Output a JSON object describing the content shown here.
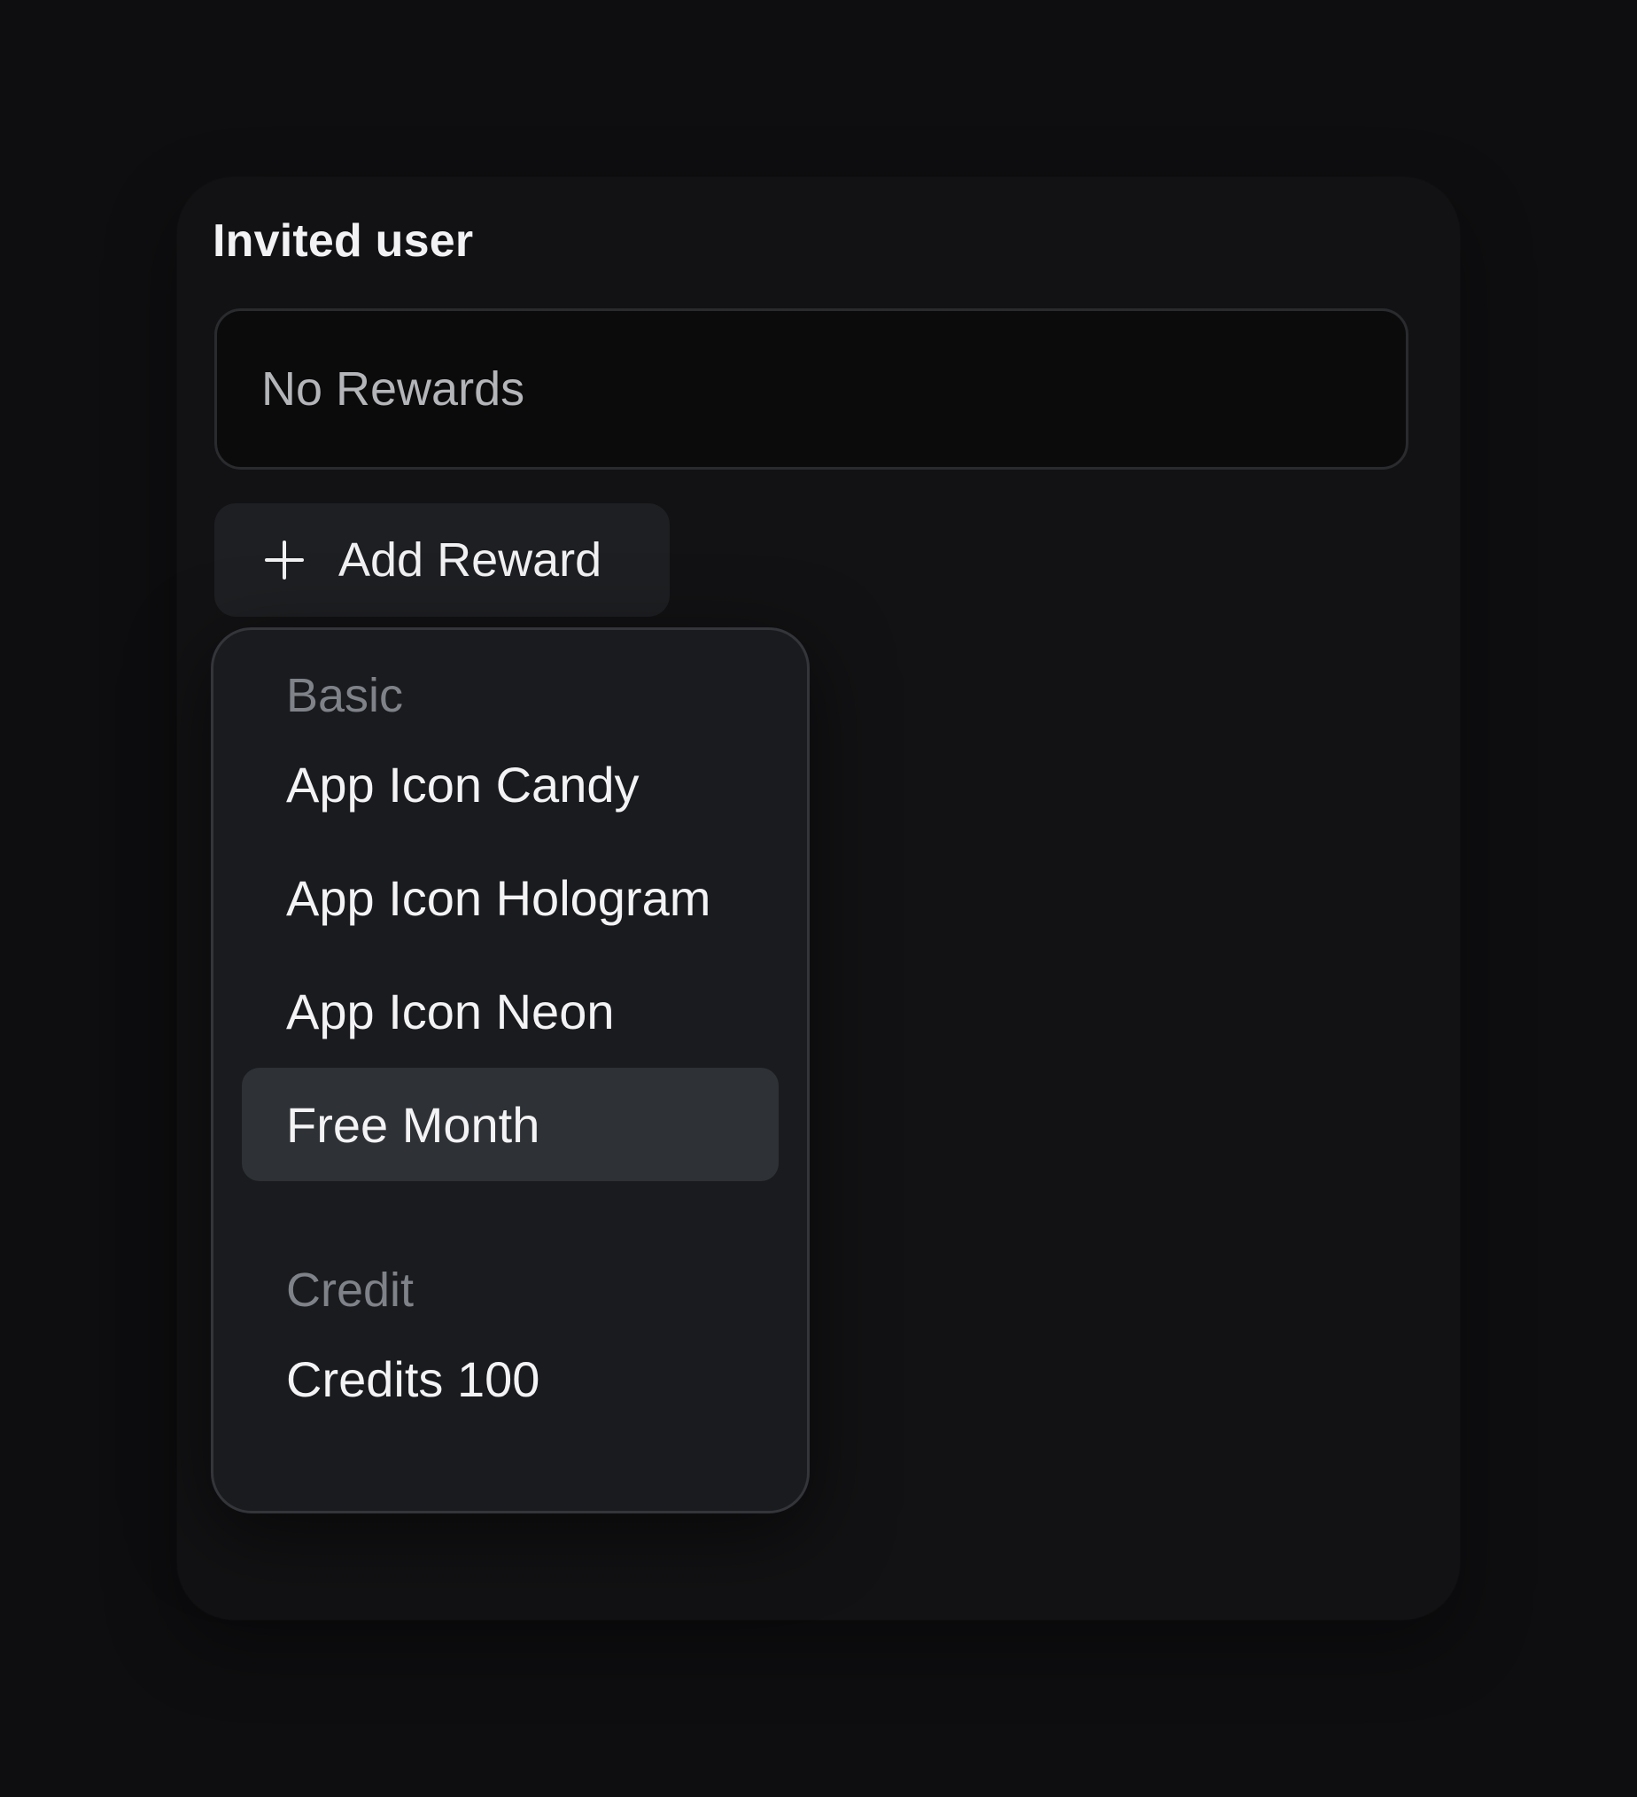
{
  "card": {
    "title": "Invited user"
  },
  "rewards": {
    "empty_label": "No Rewards"
  },
  "add_reward": {
    "label": "Add Reward",
    "icon": "plus-icon"
  },
  "menu": {
    "groups": [
      {
        "label": "Basic",
        "items": [
          {
            "label": "App Icon Candy"
          },
          {
            "label": "App Icon Hologram"
          },
          {
            "label": "App Icon Neon"
          },
          {
            "label": "Free Month",
            "highlighted": true
          }
        ]
      },
      {
        "label": "Credit",
        "items": [
          {
            "label": "Credits 100"
          }
        ]
      }
    ]
  },
  "colors": {
    "page_background": "#0e0e10",
    "card_background": "#121214",
    "menu_background": "#1a1b1e",
    "highlight": "#2e3135",
    "group_label": "#7f8288"
  }
}
